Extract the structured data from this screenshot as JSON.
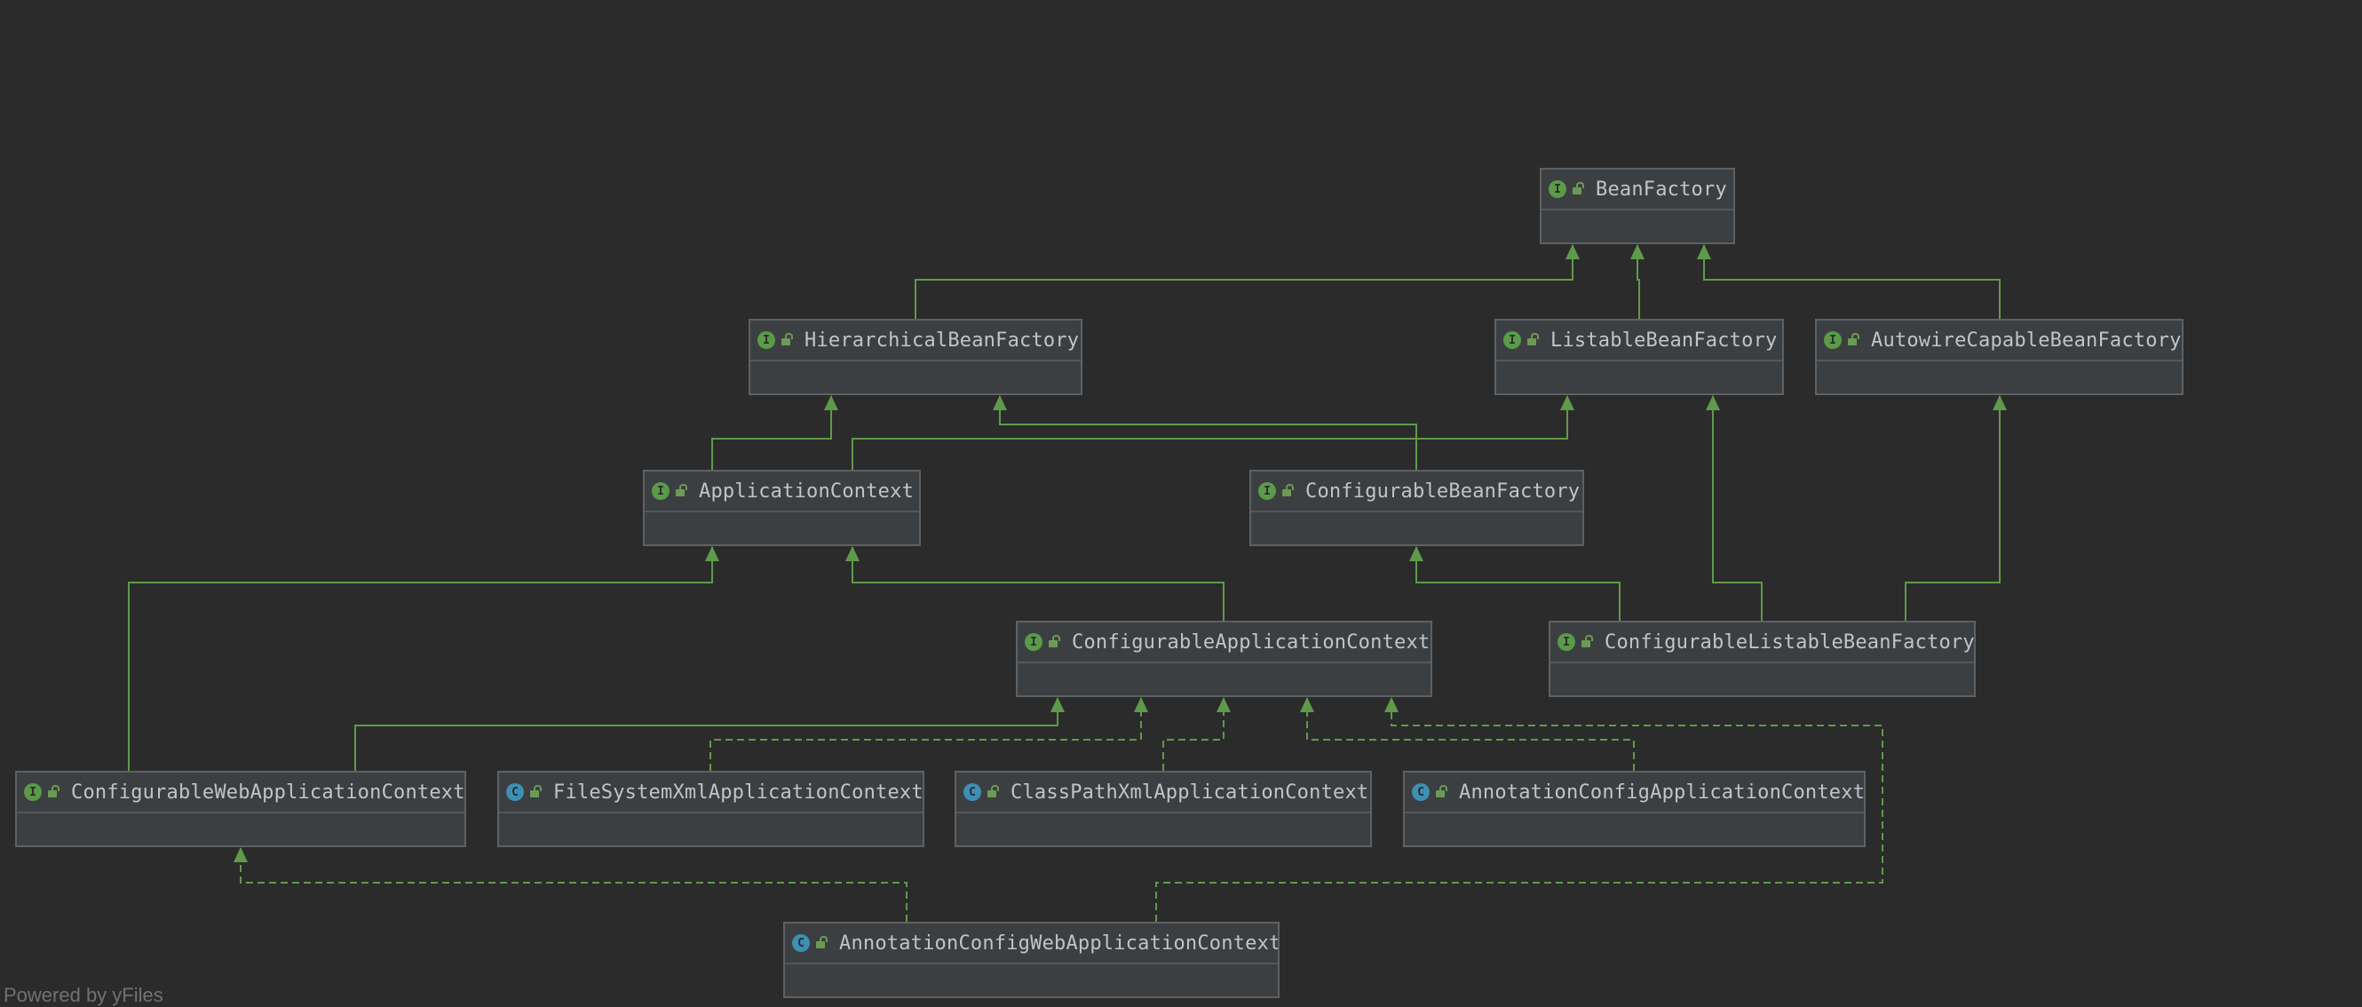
{
  "diagram": {
    "nodes": [
      {
        "id": "BeanFactory",
        "label": "BeanFactory",
        "kind": "interface"
      },
      {
        "id": "HierarchicalBeanFactory",
        "label": "HierarchicalBeanFactory",
        "kind": "interface"
      },
      {
        "id": "ListableBeanFactory",
        "label": "ListableBeanFactory",
        "kind": "interface"
      },
      {
        "id": "AutowireCapableBeanFactory",
        "label": "AutowireCapableBeanFactory",
        "kind": "interface"
      },
      {
        "id": "ApplicationContext",
        "label": "ApplicationContext",
        "kind": "interface"
      },
      {
        "id": "ConfigurableBeanFactory",
        "label": "ConfigurableBeanFactory",
        "kind": "interface"
      },
      {
        "id": "ConfigurableApplicationContext",
        "label": "ConfigurableApplicationContext",
        "kind": "interface"
      },
      {
        "id": "ConfigurableListableBeanFactory",
        "label": "ConfigurableListableBeanFactory",
        "kind": "interface"
      },
      {
        "id": "ConfigurableWebApplicationContext",
        "label": "ConfigurableWebApplicationContext",
        "kind": "interface"
      },
      {
        "id": "FileSystemXmlApplicationContext",
        "label": "FileSystemXmlApplicationContext",
        "kind": "class"
      },
      {
        "id": "ClassPathXmlApplicationContext",
        "label": "ClassPathXmlApplicationContext",
        "kind": "class"
      },
      {
        "id": "AnnotationConfigApplicationContext",
        "label": "AnnotationConfigApplicationContext",
        "kind": "class"
      },
      {
        "id": "AnnotationConfigWebApplicationContext",
        "label": "AnnotationConfigWebApplicationContext",
        "kind": "class"
      }
    ],
    "edges": [
      {
        "from": "HierarchicalBeanFactory",
        "to": "BeanFactory",
        "type": "extends"
      },
      {
        "from": "ListableBeanFactory",
        "to": "BeanFactory",
        "type": "extends"
      },
      {
        "from": "AutowireCapableBeanFactory",
        "to": "BeanFactory",
        "type": "extends"
      },
      {
        "from": "ApplicationContext",
        "to": "HierarchicalBeanFactory",
        "type": "extends"
      },
      {
        "from": "ApplicationContext",
        "to": "ListableBeanFactory",
        "type": "extends"
      },
      {
        "from": "ConfigurableBeanFactory",
        "to": "HierarchicalBeanFactory",
        "type": "extends"
      },
      {
        "from": "ConfigurableApplicationContext",
        "to": "ApplicationContext",
        "type": "extends"
      },
      {
        "from": "ConfigurableListableBeanFactory",
        "to": "ConfigurableBeanFactory",
        "type": "extends"
      },
      {
        "from": "ConfigurableListableBeanFactory",
        "to": "ListableBeanFactory",
        "type": "extends"
      },
      {
        "from": "ConfigurableListableBeanFactory",
        "to": "AutowireCapableBeanFactory",
        "type": "extends"
      },
      {
        "from": "ConfigurableWebApplicationContext",
        "to": "ApplicationContext",
        "type": "extends"
      },
      {
        "from": "ConfigurableWebApplicationContext",
        "to": "ConfigurableApplicationContext",
        "type": "extends"
      },
      {
        "from": "FileSystemXmlApplicationContext",
        "to": "ConfigurableApplicationContext",
        "type": "implements"
      },
      {
        "from": "ClassPathXmlApplicationContext",
        "to": "ConfigurableApplicationContext",
        "type": "implements"
      },
      {
        "from": "AnnotationConfigApplicationContext",
        "to": "ConfigurableApplicationContext",
        "type": "implements"
      },
      {
        "from": "AnnotationConfigWebApplicationContext",
        "to": "ConfigurableWebApplicationContext",
        "type": "implements"
      },
      {
        "from": "AnnotationConfigWebApplicationContext",
        "to": "ConfigurableApplicationContext",
        "type": "implements"
      }
    ],
    "kind_icons": {
      "interface": "I",
      "class": "C"
    },
    "colors": {
      "background": "#2b2b2b",
      "edge": "#5f9a4a",
      "node_fill": "#3c3f41",
      "node_border": "#5e6163",
      "interface_icon": "#5a9a48",
      "class_icon": "#3d8fb3"
    }
  },
  "footer": {
    "text": "Powered by yFiles"
  }
}
